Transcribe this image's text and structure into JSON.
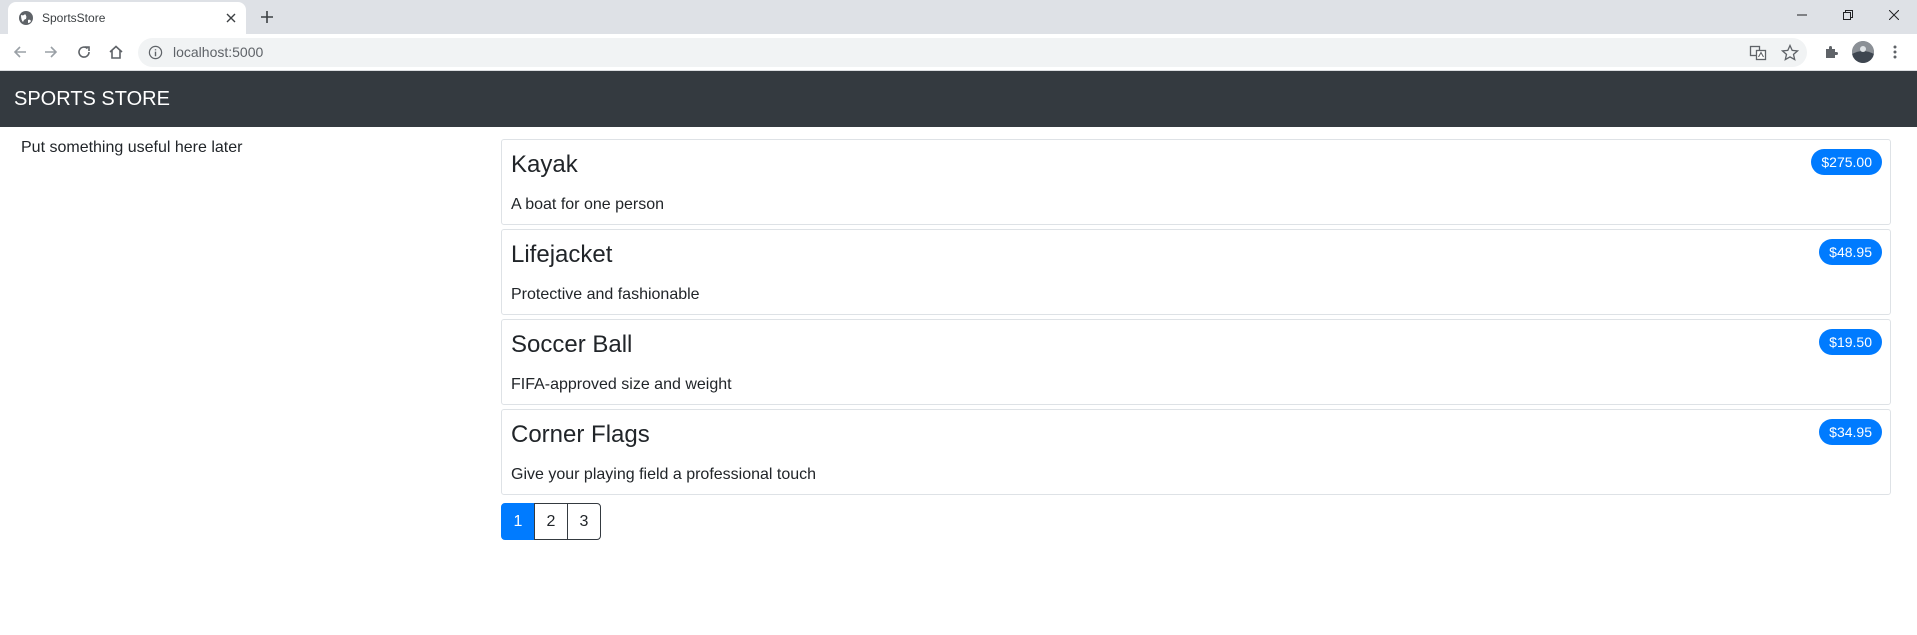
{
  "browser": {
    "tab_title": "SportsStore",
    "url": "localhost:5000",
    "icons": [
      "globe-icon",
      "close-icon",
      "plus-icon",
      "minimize-icon",
      "restore-icon",
      "back-icon",
      "forward-icon",
      "reload-icon",
      "home-icon",
      "info-icon",
      "translate-icon",
      "star-icon",
      "extensions-icon",
      "menu-icon"
    ]
  },
  "header": {
    "brand": "SPORTS STORE",
    "background": "#343a40"
  },
  "sidebar": {
    "text": "Put something useful here later"
  },
  "products": [
    {
      "name": "Kayak",
      "description": "A boat for one person",
      "price": "$275.00"
    },
    {
      "name": "Lifejacket",
      "description": "Protective and fashionable",
      "price": "$48.95"
    },
    {
      "name": "Soccer Ball",
      "description": "FIFA-approved size and weight",
      "price": "$19.50"
    },
    {
      "name": "Corner Flags",
      "description": "Give your playing field a professional touch",
      "price": "$34.95"
    }
  ],
  "pagination": {
    "pages": [
      "1",
      "2",
      "3"
    ],
    "current": "1"
  },
  "colors": {
    "accent": "#007bff"
  }
}
